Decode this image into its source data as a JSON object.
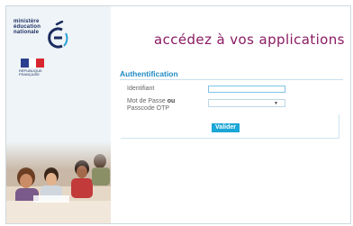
{
  "brand": {
    "ministry_lines": [
      "ministère",
      "éducation",
      "nationale"
    ],
    "big_letter": "É",
    "republique_lines": [
      "RÉPUBLIQUE",
      "FRANÇAISE"
    ],
    "colors": {
      "navy": "#1b2b5e",
      "blue_accent": "#1f8bc4",
      "title": "#8a1b63",
      "button": "#1aa6d6"
    },
    "flag_colors": [
      "#2b3f8f",
      "#ffffff",
      "#d8262e"
    ]
  },
  "page": {
    "title": "accédez à vos applications",
    "section_title": "Authentification"
  },
  "form": {
    "identifiant_label": "Identifiant",
    "identifiant_value": "",
    "password_label_line1_prefix": "Mot de Passe ",
    "password_label_or": "ou",
    "password_label_line2": "Passcode OTP",
    "password_value": "",
    "submit_label": "Valider"
  },
  "icons": {
    "dropdown": "chevron-down-icon"
  }
}
